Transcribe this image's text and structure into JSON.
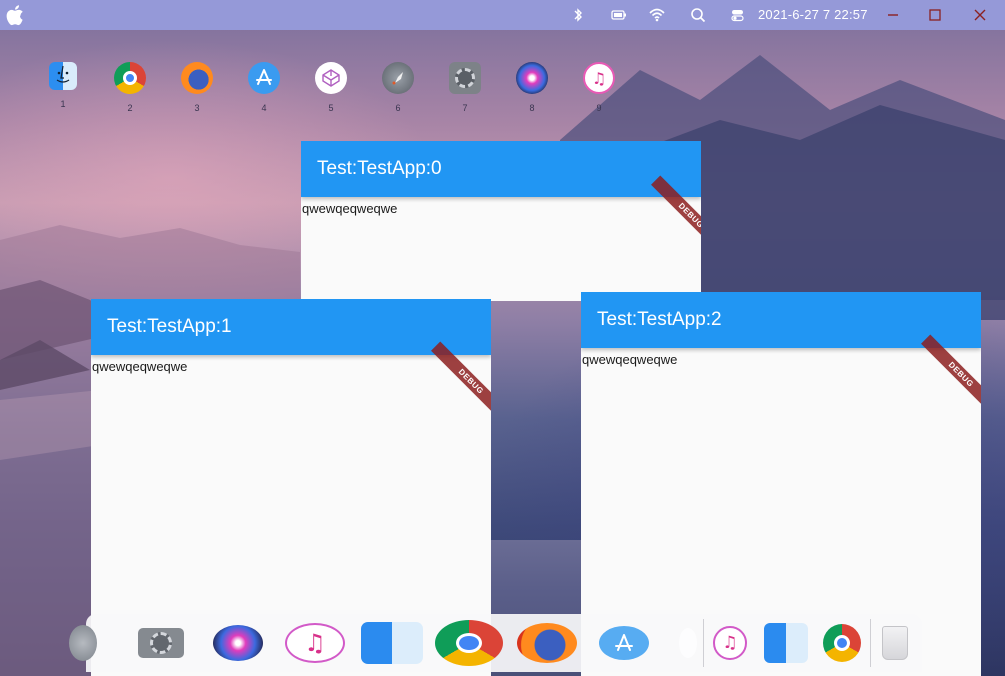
{
  "topbar": {
    "clock": "2021-6-27 7 22:57",
    "status_icons": [
      "bluetooth-icon",
      "battery-icon",
      "wifi-icon",
      "search-icon",
      "toggle-icon"
    ],
    "window_controls": [
      "minimize-icon",
      "maximize-icon",
      "close-icon"
    ],
    "background_color": "#9599d8"
  },
  "launcher": [
    {
      "icon": "finder-icon",
      "label": "1"
    },
    {
      "icon": "chrome-icon",
      "label": "2"
    },
    {
      "icon": "firefox-icon",
      "label": "3"
    },
    {
      "icon": "app-store-icon",
      "label": "4"
    },
    {
      "icon": "codepen-icon",
      "label": "5"
    },
    {
      "icon": "launchpad-icon",
      "label": "6"
    },
    {
      "icon": "system-preferences-icon",
      "label": "7"
    },
    {
      "icon": "siri-icon",
      "label": "8"
    },
    {
      "icon": "itunes-icon",
      "label": "9"
    }
  ],
  "windows": [
    {
      "title": "Test:TestApp:0",
      "text": "qwewqeqweqwe",
      "banner": "DEBUG"
    },
    {
      "title": "Test:TestApp:1",
      "text": "qwewqeqweqwe",
      "banner": "DEBUG"
    },
    {
      "title": "Test:TestApp:2",
      "text": "qwewqeqweqwe",
      "banner": "DEBUG"
    }
  ],
  "dock": {
    "items": [
      "launchpad-icon",
      "system-preferences-icon",
      "siri-icon",
      "itunes-icon",
      "finder-icon",
      "chrome-icon",
      "firefox-icon",
      "app-store-icon",
      "itunes-icon",
      "finder-icon",
      "chrome-icon",
      "trash-icon"
    ]
  },
  "colors": {
    "appbar": "#2196f3",
    "debug_banner": "#8c1e1e",
    "app_background": "#fafafa"
  }
}
